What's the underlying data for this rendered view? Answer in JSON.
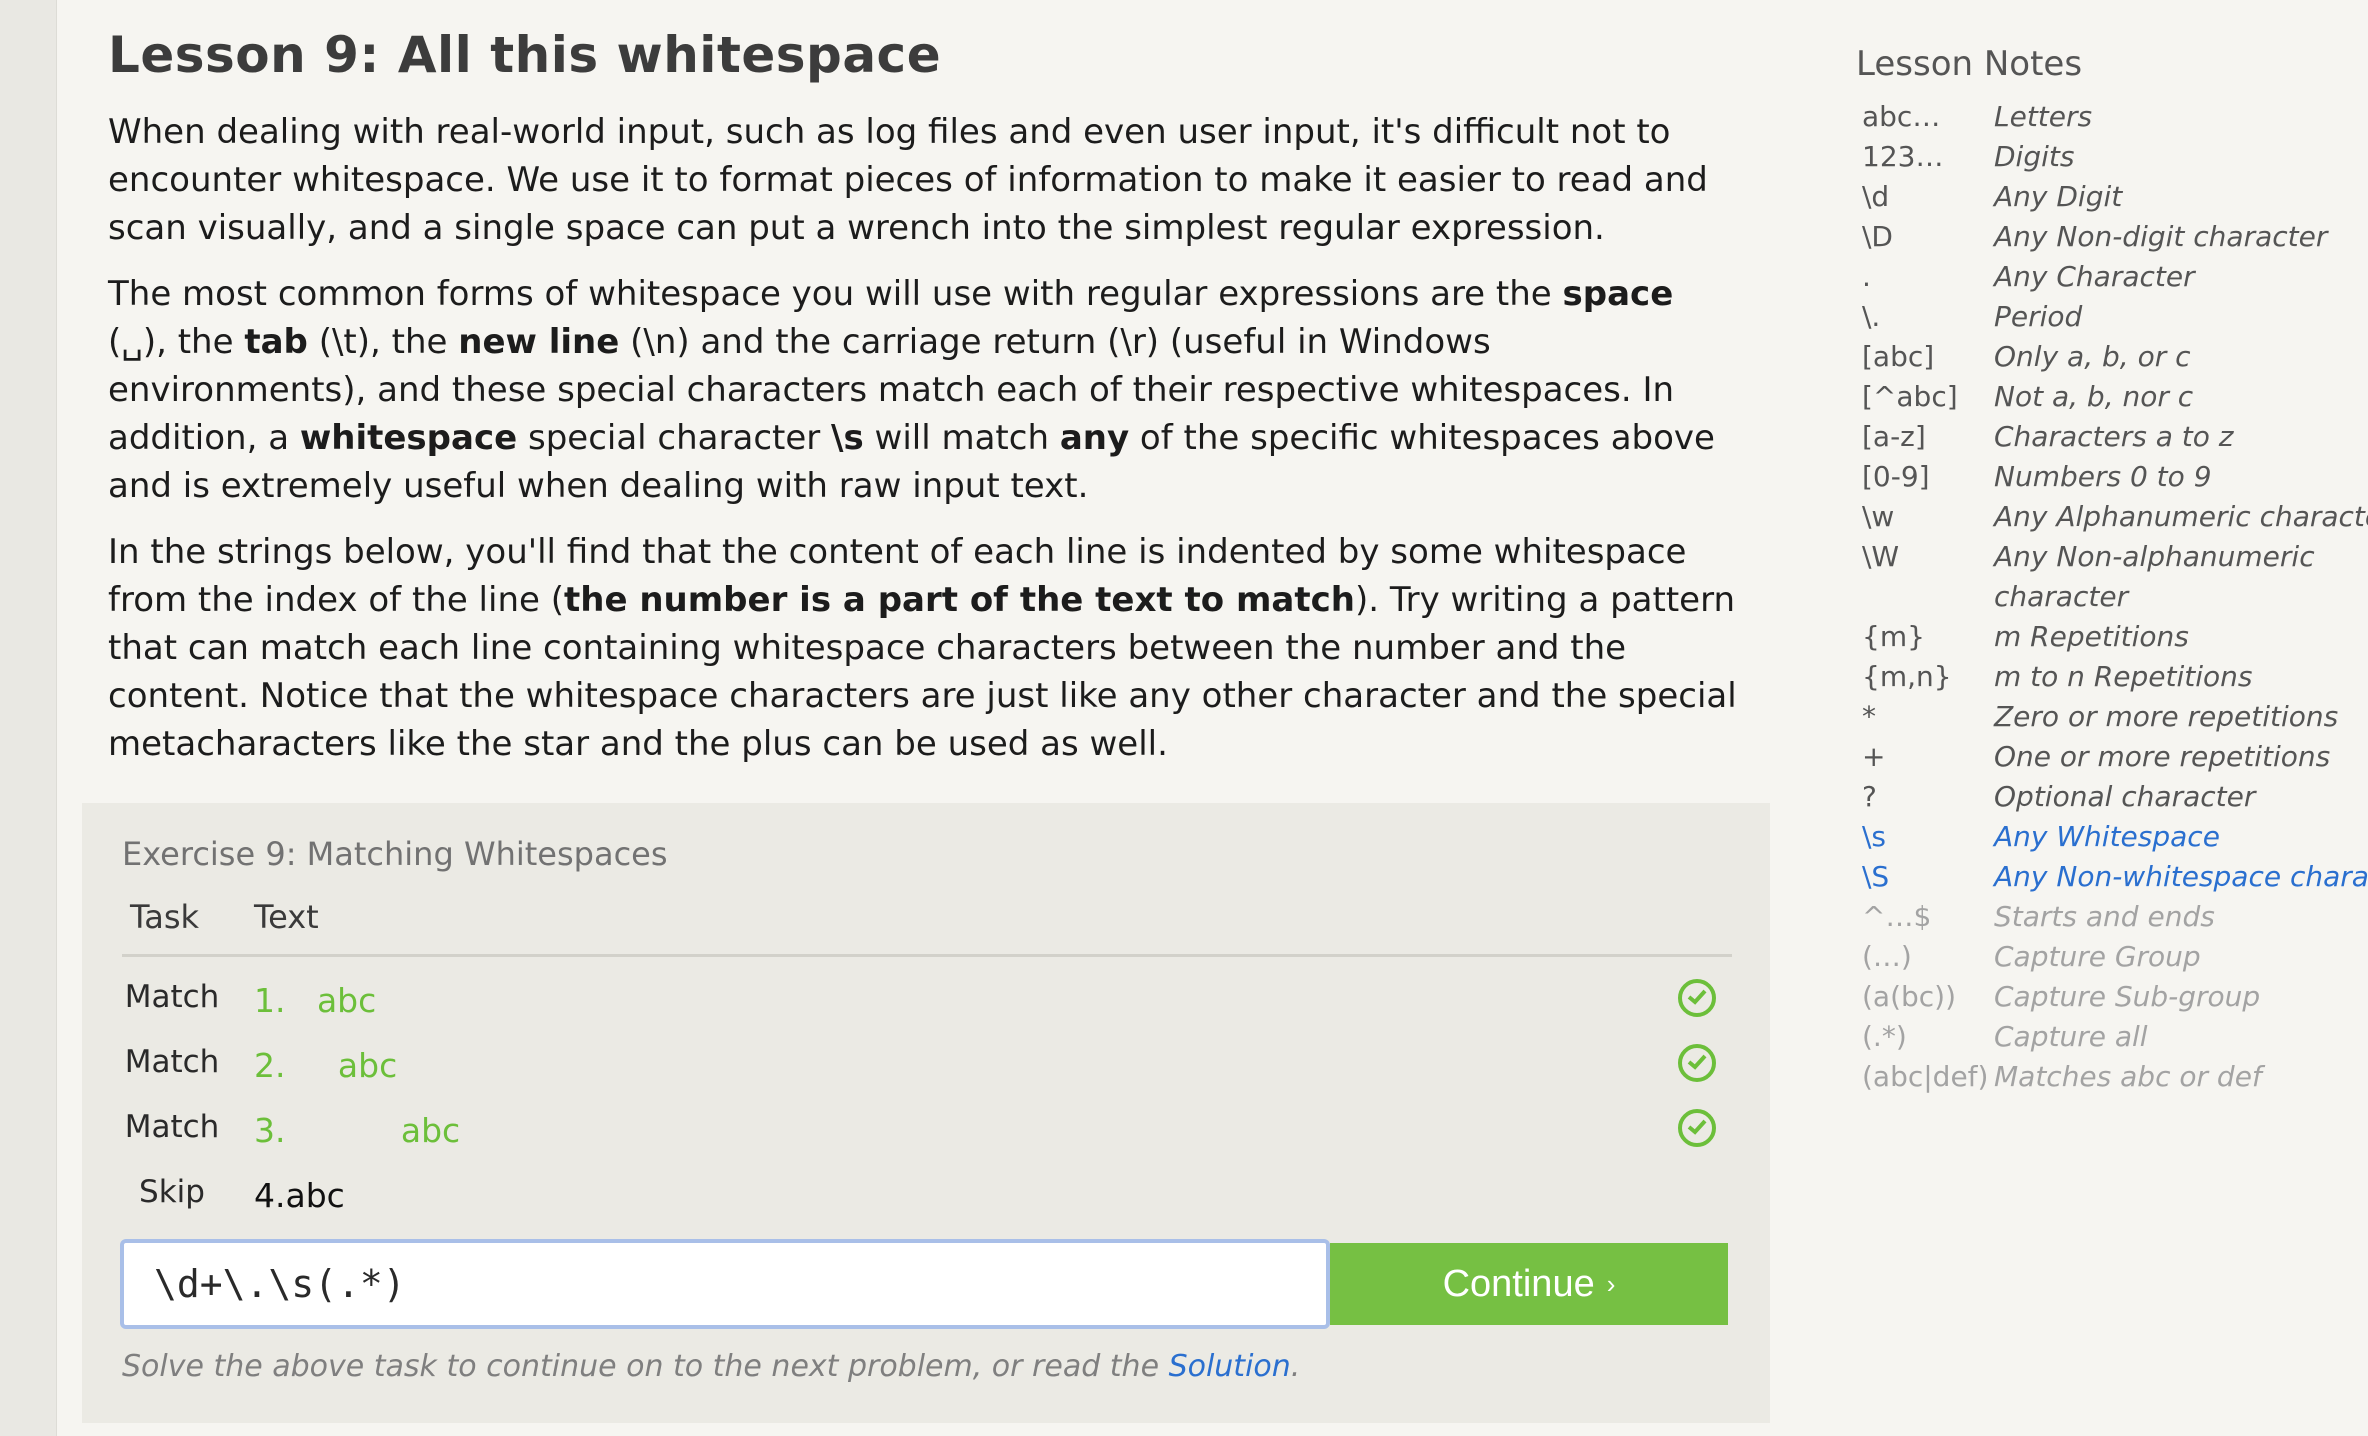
{
  "lesson": {
    "title": "Lesson 9: All this whitespace",
    "p1": "When dealing with real-world input, such as log files and even user input, it's difficult not to encounter whitespace. We use it to format pieces of information to make it easier to read and scan visually, and a single space can put a wrench into the simplest regular expression.",
    "p2": {
      "t1": "The most common forms of whitespace you will use with regular expressions are the ",
      "b1": "space",
      "t2": " (␣), the ",
      "b2": "tab",
      "t3": " (\\t), the ",
      "b3": "new line",
      "t4": " (\\n) and the carriage return (\\r) (useful in Windows environments), and these special characters match each of their respective whitespaces. In addition, a ",
      "b4": "whitespace",
      "t5": " special character ",
      "b5": "\\s",
      "t6": " will match ",
      "b6": "any",
      "t7": " of the specific whitespaces above and is extremely useful when dealing with raw input text."
    },
    "p3": {
      "t1": "In the strings below, you'll find that the content of each line is indented by some whitespace from the index of the line (",
      "b1": "the number is a part of the text to match",
      "t2": "). Try writing a pattern that can match each line containing whitespace characters between the number and the content. Notice that the whitespace characters are just like any other character and the special metacharacters like the star and the plus can be used as well."
    }
  },
  "exercise": {
    "title": "Exercise 9: Matching Whitespaces",
    "col_task": "Task",
    "col_text": "Text",
    "rows": [
      {
        "task": "Match",
        "text": "1.   abc"
      },
      {
        "task": "Match",
        "text": "2.     abc"
      },
      {
        "task": "Match",
        "text": "3.           abc"
      },
      {
        "task": "Skip",
        "text": "4.abc"
      }
    ],
    "input_value": "\\d+\\.\\s(.*)",
    "continue_label": "Continue",
    "continue_chevron": "›",
    "hint_text": "Solve the above task to continue on to the next problem, or read the ",
    "hint_link": "Solution",
    "hint_end": "."
  },
  "notes": {
    "title": "Lesson Notes",
    "items": [
      {
        "k": "abc…",
        "d": "Letters"
      },
      {
        "k": "123…",
        "d": "Digits"
      },
      {
        "k": "\\d",
        "d": "Any Digit"
      },
      {
        "k": "\\D",
        "d": "Any Non-digit character"
      },
      {
        "k": ".",
        "d": "Any Character"
      },
      {
        "k": "\\.",
        "d": "Period"
      },
      {
        "k": "[abc]",
        "d": "Only a, b, or c"
      },
      {
        "k": "[^abc]",
        "d": "Not a, b, nor c"
      },
      {
        "k": "[a-z]",
        "d": "Characters a to z"
      },
      {
        "k": "[0-9]",
        "d": "Numbers 0 to 9"
      },
      {
        "k": "\\w",
        "d": "Any Alphanumeric character"
      },
      {
        "k": "\\W",
        "d": "Any Non-alphanumeric",
        "d2": "character"
      },
      {
        "k": "{m}",
        "d": "m Repetitions"
      },
      {
        "k": "{m,n}",
        "d": "m to n Repetitions"
      },
      {
        "k": "*",
        "d": "Zero or more repetitions"
      },
      {
        "k": "+",
        "d": "One or more repetitions"
      },
      {
        "k": "?",
        "d": "Optional character"
      },
      {
        "k": "\\s",
        "d": "Any Whitespace"
      },
      {
        "k": "\\S",
        "d": "Any Non-whitespace character"
      },
      {
        "k": "^…$",
        "d": "Starts and ends"
      },
      {
        "k": "(…)",
        "d": "Capture Group"
      },
      {
        "k": "(a(bc))",
        "d": "Capture Sub-group"
      },
      {
        "k": "(.*)",
        "d": "Capture all"
      },
      {
        "k": "(abc|def)",
        "d": "Matches abc or def"
      }
    ]
  },
  "colors": {
    "accent_green": "#76c043",
    "link_blue": "#2a6fcf"
  }
}
